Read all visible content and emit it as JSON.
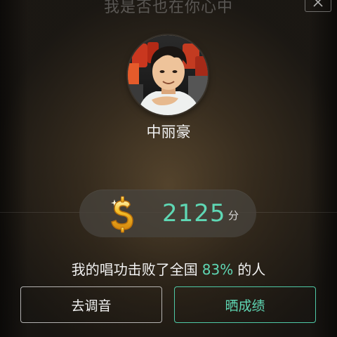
{
  "dialog": {
    "title": "我是否也在你心中"
  },
  "profile": {
    "name": "中丽豪"
  },
  "score": {
    "value": "2125",
    "unit": "分"
  },
  "result": {
    "prefix": "我的唱功击败了全国",
    "percent": "83%",
    "suffix": "的人"
  },
  "actions": {
    "tune_label": "去调音",
    "share_label": "晒成绩"
  },
  "colors": {
    "accent": "#5fd7b4",
    "share_border": "#4fc9a6",
    "coin": "#f5b81e"
  },
  "icons": {
    "close": "close-icon",
    "coin": "coin-icon",
    "avatar": "avatar"
  }
}
